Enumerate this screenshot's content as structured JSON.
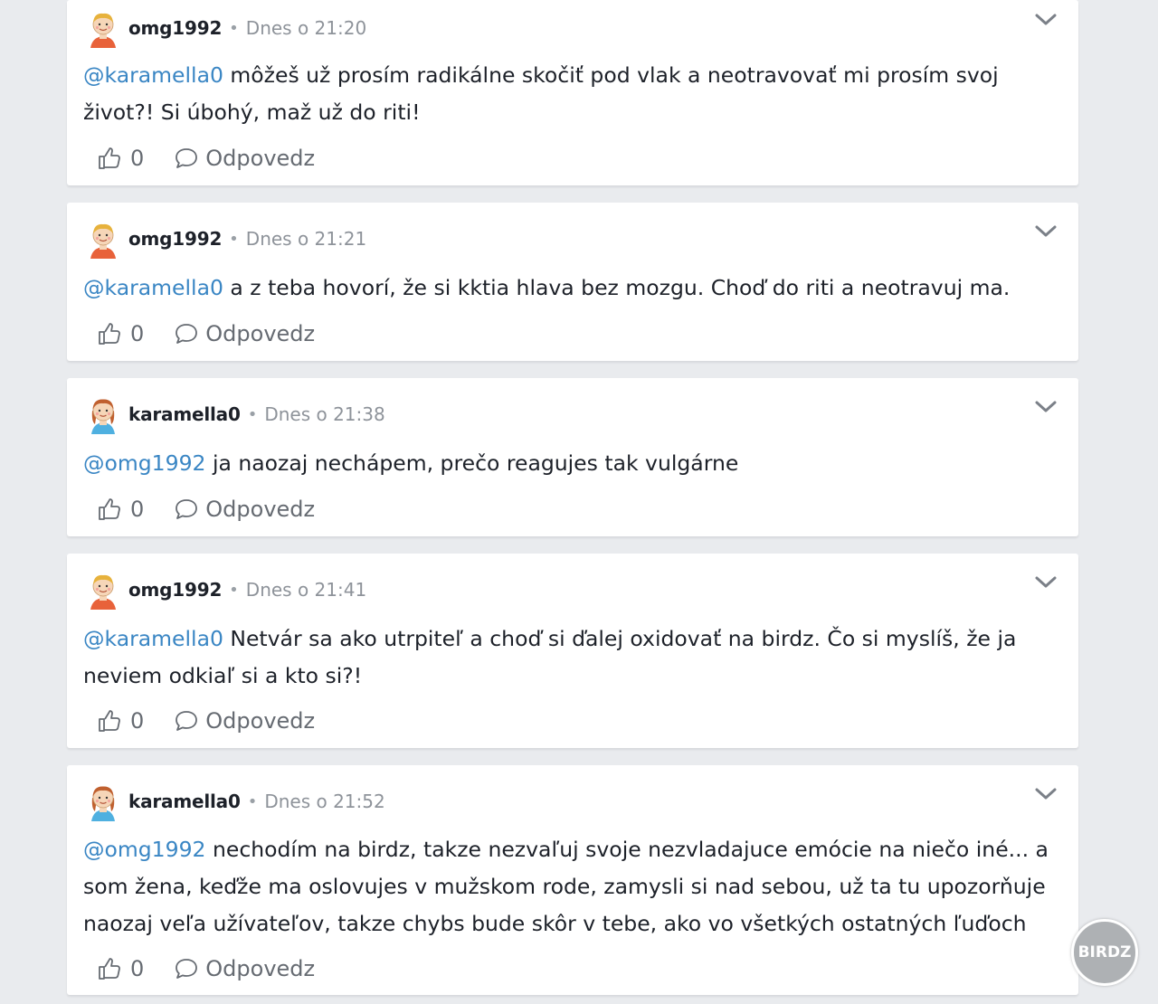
{
  "comments": [
    {
      "author": "omg1992",
      "separator": "•",
      "time": "Dnes o 21:20",
      "mention": "@karamella0",
      "text": " môžeš už prosím radikálne skočiť pod vlak a neotravovať mi prosím svoj život?! Si úbohý, maž už do riti!",
      "likes": "0",
      "reply_label": "Odpovedz"
    },
    {
      "author": "omg1992",
      "separator": "•",
      "time": "Dnes o 21:21",
      "mention": "@karamella0",
      "text": " a z teba hovorí, že si kktia hlava bez mozgu. Choď do riti a neotravuj ma.",
      "likes": "0",
      "reply_label": "Odpovedz"
    },
    {
      "author": "karamella0",
      "separator": "•",
      "time": "Dnes o 21:38",
      "mention": "@omg1992",
      "text": " ja naozaj nechápem, prečo reagujes tak vulgárne",
      "likes": "0",
      "reply_label": "Odpovedz"
    },
    {
      "author": "omg1992",
      "separator": "•",
      "time": "Dnes o 21:41",
      "mention": "@karamella0",
      "text": " Netvár sa ako utrpiteľ a choď si ďalej oxidovať na birdz. Čo si myslíš, že ja neviem odkiaľ si a kto si?!",
      "likes": "0",
      "reply_label": "Odpovedz"
    },
    {
      "author": "karamella0",
      "separator": "•",
      "time": "Dnes o 21:52",
      "mention": "@omg1992",
      "text": " nechodím na birdz, takze nezvaľuj svoje nezvladajuce emócie na niečo iné... a som žena, keďže ma oslovujes v mužskom rode, zamysli si nad sebou, už ta tu upozorňuje naozaj veľa užívateľov, takze chybs bude skôr v tebe, ako vo všetkých ostatných ľuďoch",
      "likes": "0",
      "reply_label": "Odpovedz"
    }
  ],
  "watermark": "BIRDZ",
  "colors": {
    "page_bg": "#e9ebee",
    "card_bg": "#ffffff",
    "mention": "#3a86c4",
    "muted": "#8e939a",
    "action": "#666b72"
  },
  "icons": {
    "like": "thumbs-up-icon",
    "reply": "speech-bubble-icon",
    "menu": "chevron-down-icon",
    "avatar_boy": "boy-avatar-icon",
    "avatar_girl": "girl-avatar-icon"
  }
}
